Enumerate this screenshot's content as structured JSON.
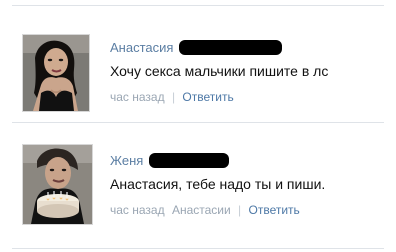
{
  "comments": [
    {
      "author": "Анастасия",
      "text": "Хочу секса мальчики пишите в лс",
      "time": "час назад",
      "reply_label": "Ответить",
      "avatar_icon": "avatar-photo-icon"
    },
    {
      "author": "Женя",
      "text": "Анастасия, тебе надо ты и пиши.",
      "time": "час назад",
      "reply_to": "Анастасии",
      "reply_label": "Ответить",
      "avatar_icon": "avatar-photo-icon"
    }
  ],
  "meta_separator": "|",
  "colors": {
    "author": "#5b7ea3",
    "meta": "#9aa6b3",
    "link": "#4d78a6",
    "divider": "#dfe3e8",
    "redaction": "#000000"
  }
}
